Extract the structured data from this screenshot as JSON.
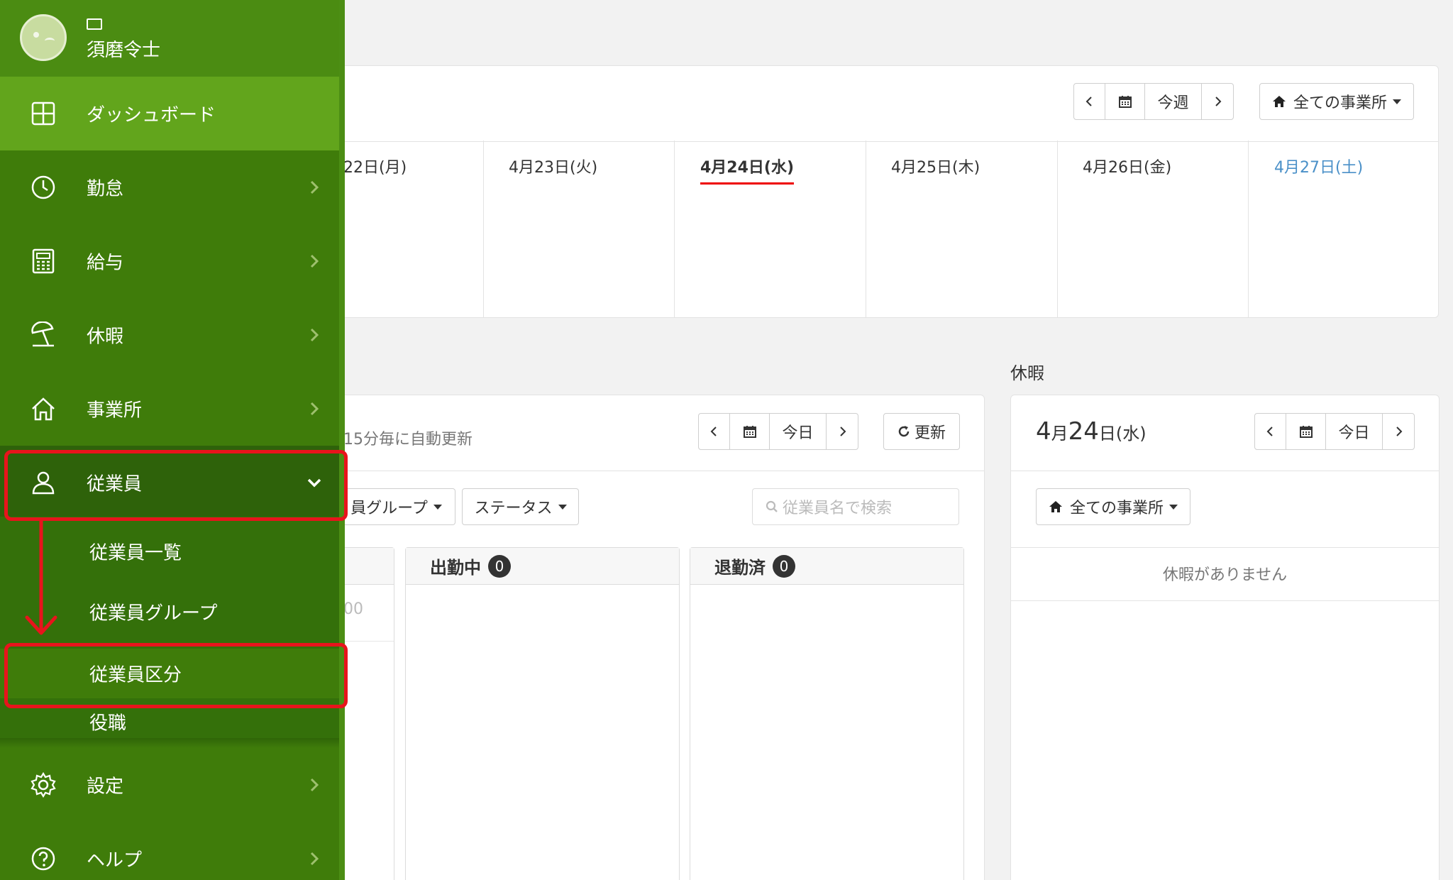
{
  "user": {
    "name": "須磨令士"
  },
  "sidebar": {
    "items": [
      {
        "label": "ダッシュボード",
        "icon": "dashboard-icon"
      },
      {
        "label": "勤怠",
        "icon": "clock-icon"
      },
      {
        "label": "給与",
        "icon": "calculator-icon"
      },
      {
        "label": "休暇",
        "icon": "beach-umbrella-icon"
      },
      {
        "label": "事業所",
        "icon": "home-icon"
      },
      {
        "label": "従業員",
        "icon": "person-icon"
      },
      {
        "label": "設定",
        "icon": "gear-icon"
      },
      {
        "label": "ヘルプ",
        "icon": "question-icon"
      }
    ],
    "employee_submenu": [
      {
        "label": "従業員一覧"
      },
      {
        "label": "従業員グループ"
      },
      {
        "label": "従業員区分"
      },
      {
        "label": "役職"
      }
    ]
  },
  "schedule": {
    "this_week_label": "今週",
    "office_filter": "全ての事業所",
    "days": [
      "22日(月)",
      "4月23日(火)",
      "4月24日(水)",
      "4月25日(木)",
      "4月26日(金)",
      "4月27日(土)"
    ]
  },
  "attendance": {
    "auto_refresh_note": "15分毎に自動更新",
    "today_label": "今日",
    "refresh_label": "更新",
    "group_filter": "員グループ",
    "status_filter": "ステータス",
    "search_placeholder": "従業員名で検索",
    "partial_cell": "00",
    "columns": [
      {
        "title": "出勤中",
        "count": "0"
      },
      {
        "title": "退勤済",
        "count": "0"
      }
    ]
  },
  "vacation": {
    "section_title": "休暇",
    "month": "4",
    "month_unit": "月",
    "day": "24",
    "day_unit": "日",
    "weekday": "(水)",
    "today_label": "今日",
    "office_filter": "全ての事業所",
    "empty_message": "休暇がありません"
  },
  "colors": {
    "sidebar_bg": "#3f7c0a",
    "active_item": "#62a51c",
    "open_item": "#2e620a",
    "highlight_red": "#e8141c",
    "today_underline": "#ee0000",
    "saturday_blue": "#4a90c8"
  }
}
